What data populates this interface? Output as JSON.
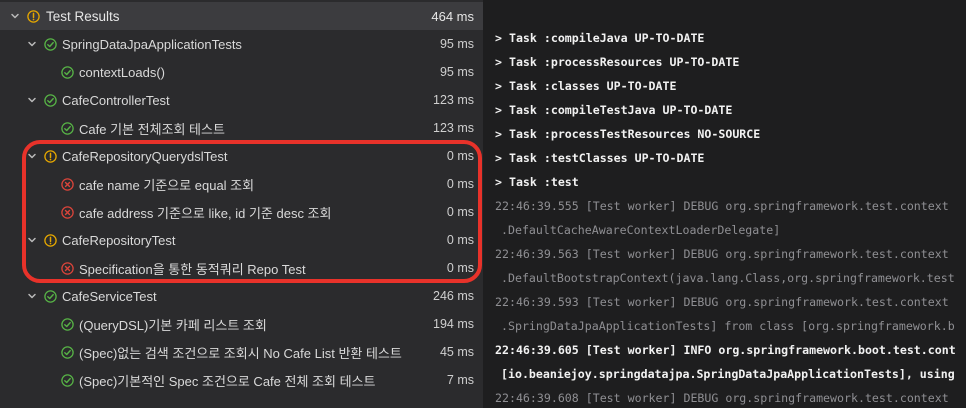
{
  "colors": {
    "pass": "#57b346",
    "warn": "#e5a700",
    "fail": "#d9443a",
    "highlight": "#e8322a"
  },
  "tree": {
    "header": {
      "label": "Test Results",
      "duration": "464 ms",
      "status": "warn"
    },
    "rows": [
      {
        "label": "SpringDataJpaApplicationTests",
        "duration": "95 ms",
        "status": "pass",
        "level": 1,
        "expandable": true
      },
      {
        "label": "contextLoads()",
        "duration": "95 ms",
        "status": "pass",
        "level": 2,
        "expandable": false
      },
      {
        "label": "CafeControllerTest",
        "duration": "123 ms",
        "status": "pass",
        "level": 1,
        "expandable": true
      },
      {
        "label": "Cafe 기본 전체조회 테스트",
        "duration": "123 ms",
        "status": "pass",
        "level": 2,
        "expandable": false
      },
      {
        "label": "CafeRepositoryQuerydslTest",
        "duration": "0 ms",
        "status": "warn",
        "level": 1,
        "expandable": true
      },
      {
        "label": "cafe name 기준으로 equal 조회",
        "duration": "0 ms",
        "status": "fail",
        "level": 2,
        "expandable": false
      },
      {
        "label": "cafe address 기준으로 like, id 기준 desc 조회",
        "duration": "0 ms",
        "status": "fail",
        "level": 2,
        "expandable": false
      },
      {
        "label": "CafeRepositoryTest",
        "duration": "0 ms",
        "status": "warn",
        "level": 1,
        "expandable": true
      },
      {
        "label": "Specification을 통한 동적쿼리 Repo Test",
        "duration": "0 ms",
        "status": "fail",
        "level": 2,
        "expandable": false
      },
      {
        "label": "CafeServiceTest",
        "duration": "246 ms",
        "status": "pass",
        "level": 1,
        "expandable": true
      },
      {
        "label": "(QueryDSL)기본 카페 리스트 조회",
        "duration": "194 ms",
        "status": "pass",
        "level": 2,
        "expandable": false
      },
      {
        "label": "(Spec)없는 검색 조건으로 조회시 No Cafe List 반환 테스트",
        "duration": "45 ms",
        "status": "pass",
        "level": 2,
        "expandable": false
      },
      {
        "label": "(Spec)기본적인 Spec 조건으로 Cafe 전체 조회 테스트",
        "duration": "7 ms",
        "status": "pass",
        "level": 2,
        "expandable": false
      }
    ]
  },
  "console": {
    "lines": [
      {
        "text": "> Task :compileJava UP-TO-DATE",
        "kind": "task"
      },
      {
        "text": "> Task :processResources UP-TO-DATE",
        "kind": "task"
      },
      {
        "text": "> Task :classes UP-TO-DATE",
        "kind": "task"
      },
      {
        "text": "> Task :compileTestJava UP-TO-DATE",
        "kind": "task"
      },
      {
        "text": "> Task :processTestResources NO-SOURCE",
        "kind": "task"
      },
      {
        "text": "> Task :testClasses UP-TO-DATE",
        "kind": "task"
      },
      {
        "text": "> Task :test",
        "kind": "task"
      },
      {
        "text": "22:46:39.555 [Test worker] DEBUG org.springframework.test.context",
        "kind": "debug"
      },
      {
        "text": ".DefaultCacheAwareContextLoaderDelegate]",
        "kind": "debug-cont"
      },
      {
        "text": "22:46:39.563 [Test worker] DEBUG org.springframework.test.context",
        "kind": "debug"
      },
      {
        "text": ".DefaultBootstrapContext(java.lang.Class,org.springframework.test",
        "kind": "debug-cont"
      },
      {
        "text": "22:46:39.593 [Test worker] DEBUG org.springframework.test.context",
        "kind": "debug"
      },
      {
        "text": ".SpringDataJpaApplicationTests] from class [org.springframework.b",
        "kind": "debug-cont"
      },
      {
        "text": "22:46:39.605 [Test worker] INFO org.springframework.boot.test.cont",
        "kind": "info"
      },
      {
        "text": "[io.beaniejoy.springdatajpa.SpringDataJpaApplicationTests], using",
        "kind": "info-cont"
      },
      {
        "text": "22:46:39.608 [Test worker] DEBUG org.springframework.test.context",
        "kind": "debug"
      }
    ]
  }
}
